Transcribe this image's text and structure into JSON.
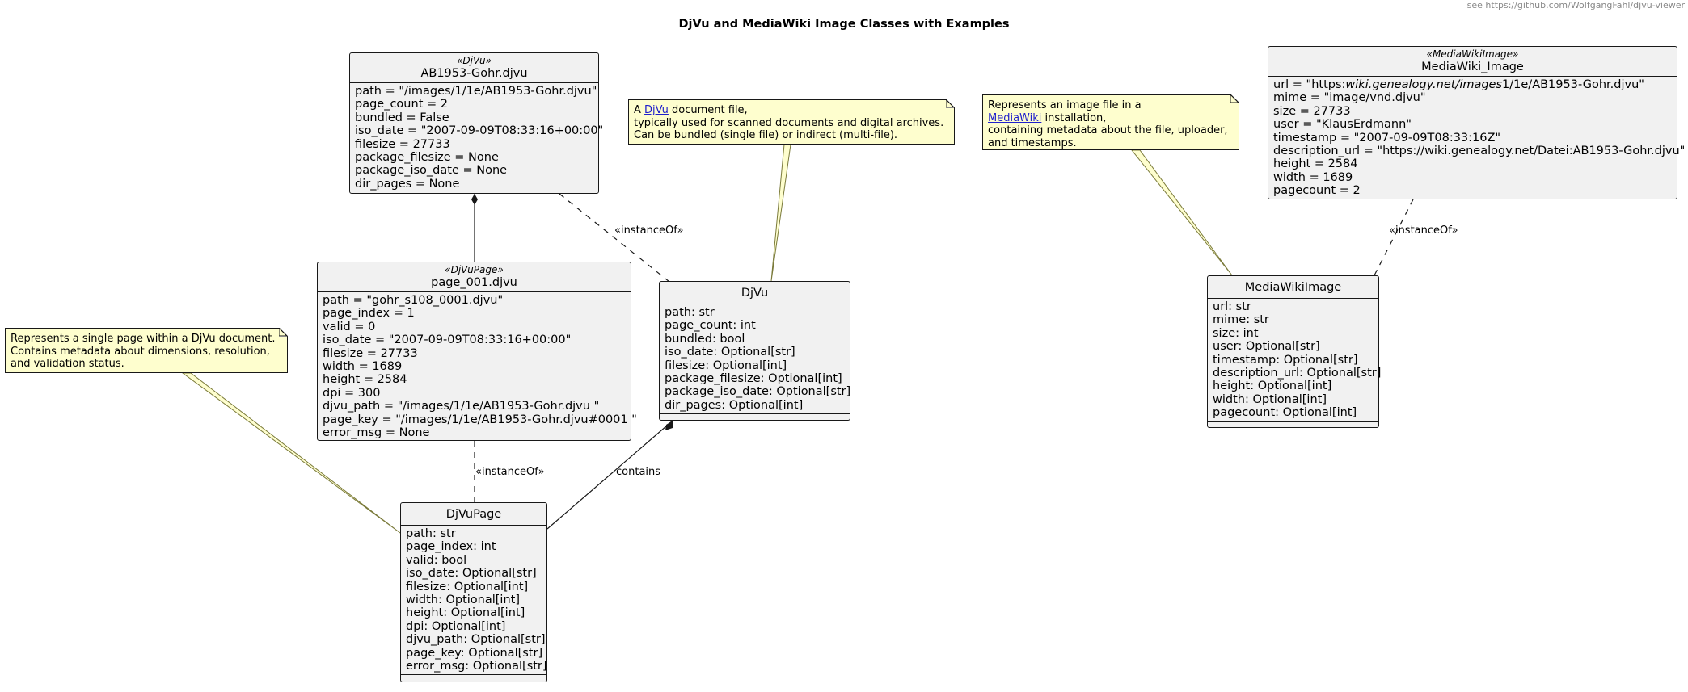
{
  "header": {
    "link_text": "see https://github.com/WolfgangFahl/djvu-viewer"
  },
  "title": "DjVu and MediaWiki Image Classes with Examples",
  "objects": {
    "ab1953": {
      "stereotype": "«DjVu»",
      "name": "AB1953-Gohr.djvu",
      "fields": [
        "path = \"/images/1/1e/AB1953-Gohr.djvu\"",
        "page_count = 2",
        "bundled = False",
        "iso_date = \"2007-09-09T08:33:16+00:00\"",
        "filesize = 27733",
        "package_filesize = None",
        "package_iso_date = None",
        "dir_pages = None"
      ]
    },
    "page001": {
      "stereotype": "«DjVuPage»",
      "name": "page_001.djvu",
      "fields": [
        "path = \"gohr_s108_0001.djvu\"",
        "page_index = 1",
        "valid = 0",
        "iso_date = \"2007-09-09T08:33:16+00:00\"",
        "filesize = 27733",
        "width = 1689",
        "height = 2584",
        "dpi = 300",
        "djvu_path = \"/images/1/1e/AB1953-Gohr.djvu \"",
        "page_key = \"/images/1/1e/AB1953-Gohr.djvu#0001 \"",
        "error_msg = None"
      ]
    },
    "mwimage": {
      "stereotype": "«MediaWikiImage»",
      "name": "MediaWiki_Image",
      "fields": [
        "url = \"https:",
        "mime = \"image/vnd.djvu\"",
        "size = 27733",
        "user = \"KlausErdmann\"",
        "timestamp = \"2007-09-09T08:33:16Z\"",
        "description_url = \"https://wiki.genealogy.net/Datei:AB1953-Gohr.djvu\"",
        "height = 2584",
        "width = 1689",
        "pagecount = 2"
      ],
      "url_italic": "wiki.genealogy.net/images",
      "url_tail": "1/1e/AB1953-Gohr.djvu\""
    }
  },
  "classes": {
    "djvu": {
      "name": "DjVu",
      "fields": [
        "path: str",
        "page_count: int",
        "bundled: bool",
        "iso_date: Optional[str]",
        "filesize: Optional[int]",
        "package_filesize: Optional[int]",
        "package_iso_date: Optional[str]",
        "dir_pages: Optional[int]"
      ]
    },
    "djvupage": {
      "name": "DjVuPage",
      "fields": [
        "path: str",
        "page_index: int",
        "valid: bool",
        "iso_date: Optional[str]",
        "filesize: Optional[int]",
        "width: Optional[int]",
        "height: Optional[int]",
        "dpi: Optional[int]",
        "djvu_path: Optional[str]",
        "page_key: Optional[str]",
        "error_msg: Optional[str]"
      ]
    },
    "mediawikiimage": {
      "name": "MediaWikiImage",
      "fields": [
        "url: str",
        "mime: str",
        "size: int",
        "user: Optional[str]",
        "timestamp: Optional[str]",
        "description_url: Optional[str]",
        "height: Optional[int]",
        "width: Optional[int]",
        "pagecount: Optional[int]"
      ]
    }
  },
  "notes": {
    "djvu": {
      "line1_pre": "A ",
      "line1_link": "DjVu",
      "line1_post": " document file,",
      "line2": "typically used for scanned documents and digital archives.",
      "line3": "Can be bundled (single file) or indirect (multi-file)."
    },
    "mediawiki": {
      "line1": "Represents an image file in a",
      "line2_link": "MediaWiki",
      "line2_post": " installation,",
      "line3": "containing metadata about the file, uploader,",
      "line4": "and timestamps."
    },
    "djvupage": {
      "line1": "Represents a single page within a DjVu document.",
      "line2": "Contains metadata about dimensions, resolution,",
      "line3": "and validation status."
    }
  },
  "relations": {
    "instance_of": "«instanceOf»",
    "contains": "contains"
  }
}
